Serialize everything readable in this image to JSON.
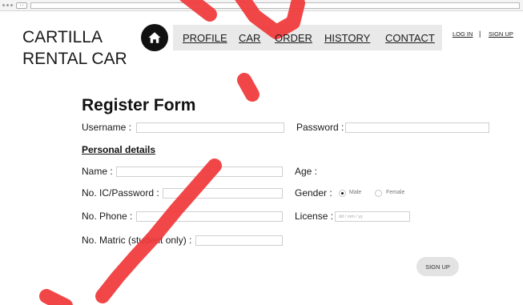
{
  "header": {
    "brand_line1": "CARTILLA",
    "brand_line2": "RENTAL CAR",
    "nav": [
      "PROFILE",
      "CAR",
      "ORDER",
      "HISTORY",
      "CONTACT"
    ],
    "login": "LOG IN",
    "separator": "|",
    "signup": "SIGN UP"
  },
  "form": {
    "title": "Register Form",
    "username_label": "Username :",
    "password_label": "Password :",
    "section_title": "Personal details",
    "name_label": "Name :",
    "age_label": "Age :",
    "ic_label": "No. IC/Password :",
    "gender_label": "Gender :",
    "gender_male": "Male",
    "gender_female": "Female",
    "phone_label": "No. Phone :",
    "license_label": "License :",
    "license_placeholder": "dd / mm / yy",
    "matric_label": "No. Matric (student only) :",
    "submit_label": "SIGN UP"
  },
  "colors": {
    "watermark": "#f0393a",
    "navbar_bg": "#e9e9e9",
    "button_bg": "#e3e3e3"
  },
  "icons": {
    "home": "home-icon"
  }
}
